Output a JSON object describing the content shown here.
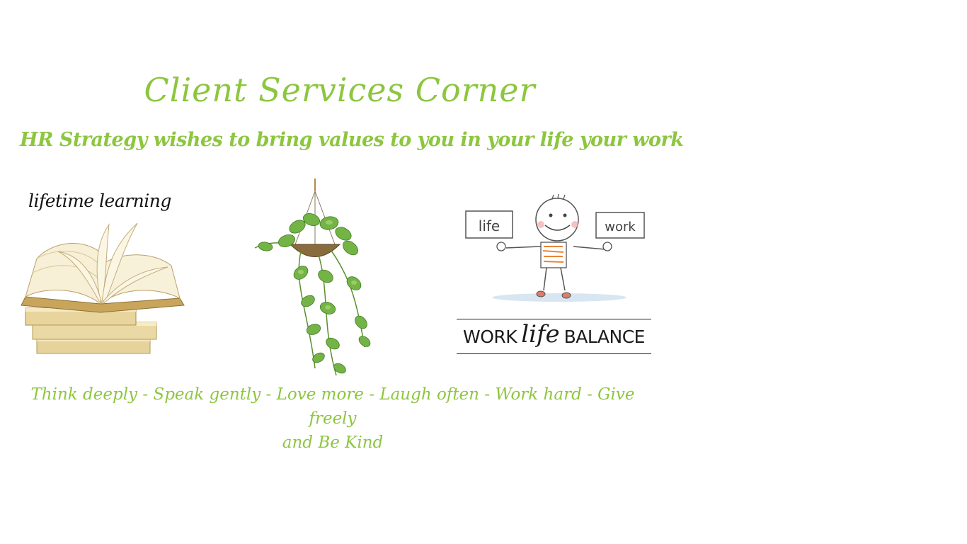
{
  "heading": {
    "title": "Client Services Corner",
    "tagline": "HR Strategy wishes to bring values to you in your life your work"
  },
  "panels": {
    "learning": {
      "label": "lifetime learning",
      "icon": "open-books-stack"
    },
    "plant": {
      "icon": "hanging-pothos-plant"
    },
    "balance": {
      "sign_left": "life",
      "sign_right": "work",
      "caption_left": "WORK",
      "caption_middle": "life",
      "caption_right": "BALANCE",
      "icon": "stick-figure-holding-signs"
    }
  },
  "quote": {
    "line1": "Think deeply - Speak gently - Love more - Laugh often - Work hard - Give freely",
    "line2": "and Be Kind"
  },
  "colors": {
    "accent": "#8dc63f",
    "text_dark": "#111111",
    "background": "#ffffff"
  }
}
